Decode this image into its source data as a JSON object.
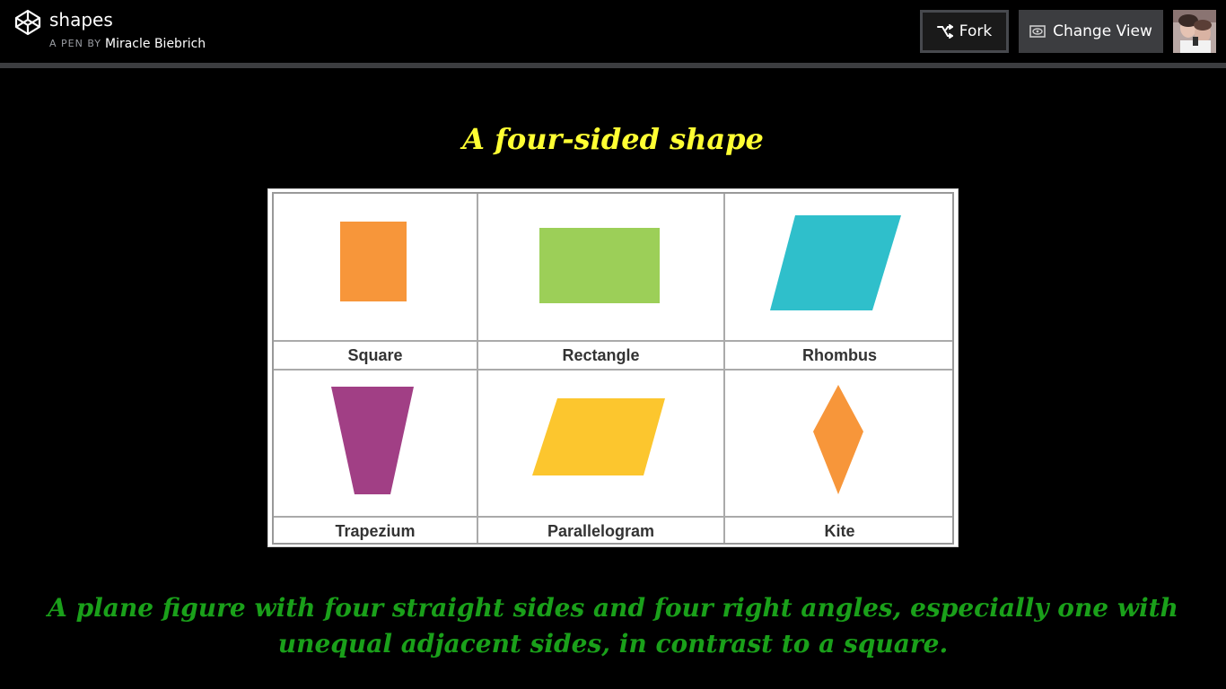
{
  "pen": {
    "title": "shapes",
    "by_label": "A PEN BY",
    "author": "Miracle Biebrich"
  },
  "toolbar": {
    "fork_label": "Fork",
    "change_view_label": "Change View"
  },
  "content": {
    "subtitle": "A four-sided shape",
    "definition": "A plane figure with four straight sides and four right angles, especially one with unequal adjacent sides, in contrast to a square."
  },
  "shapes": {
    "labels": [
      "Square",
      "Rectangle",
      "Rhombus",
      "Trapezium",
      "Parallelogram",
      "Kite"
    ],
    "colors": {
      "square": "#f7963a",
      "rectangle": "#9ccf58",
      "rhombus": "#2fbfcb",
      "trapezium": "#a13f85",
      "parallelogram": "#fcc62e",
      "kite": "#f7963a"
    }
  },
  "colors": {
    "subtitle": "#ffff33",
    "definition": "#1aa01a",
    "heading": "#ff8c00",
    "topbar_border": "#3c3d40"
  }
}
